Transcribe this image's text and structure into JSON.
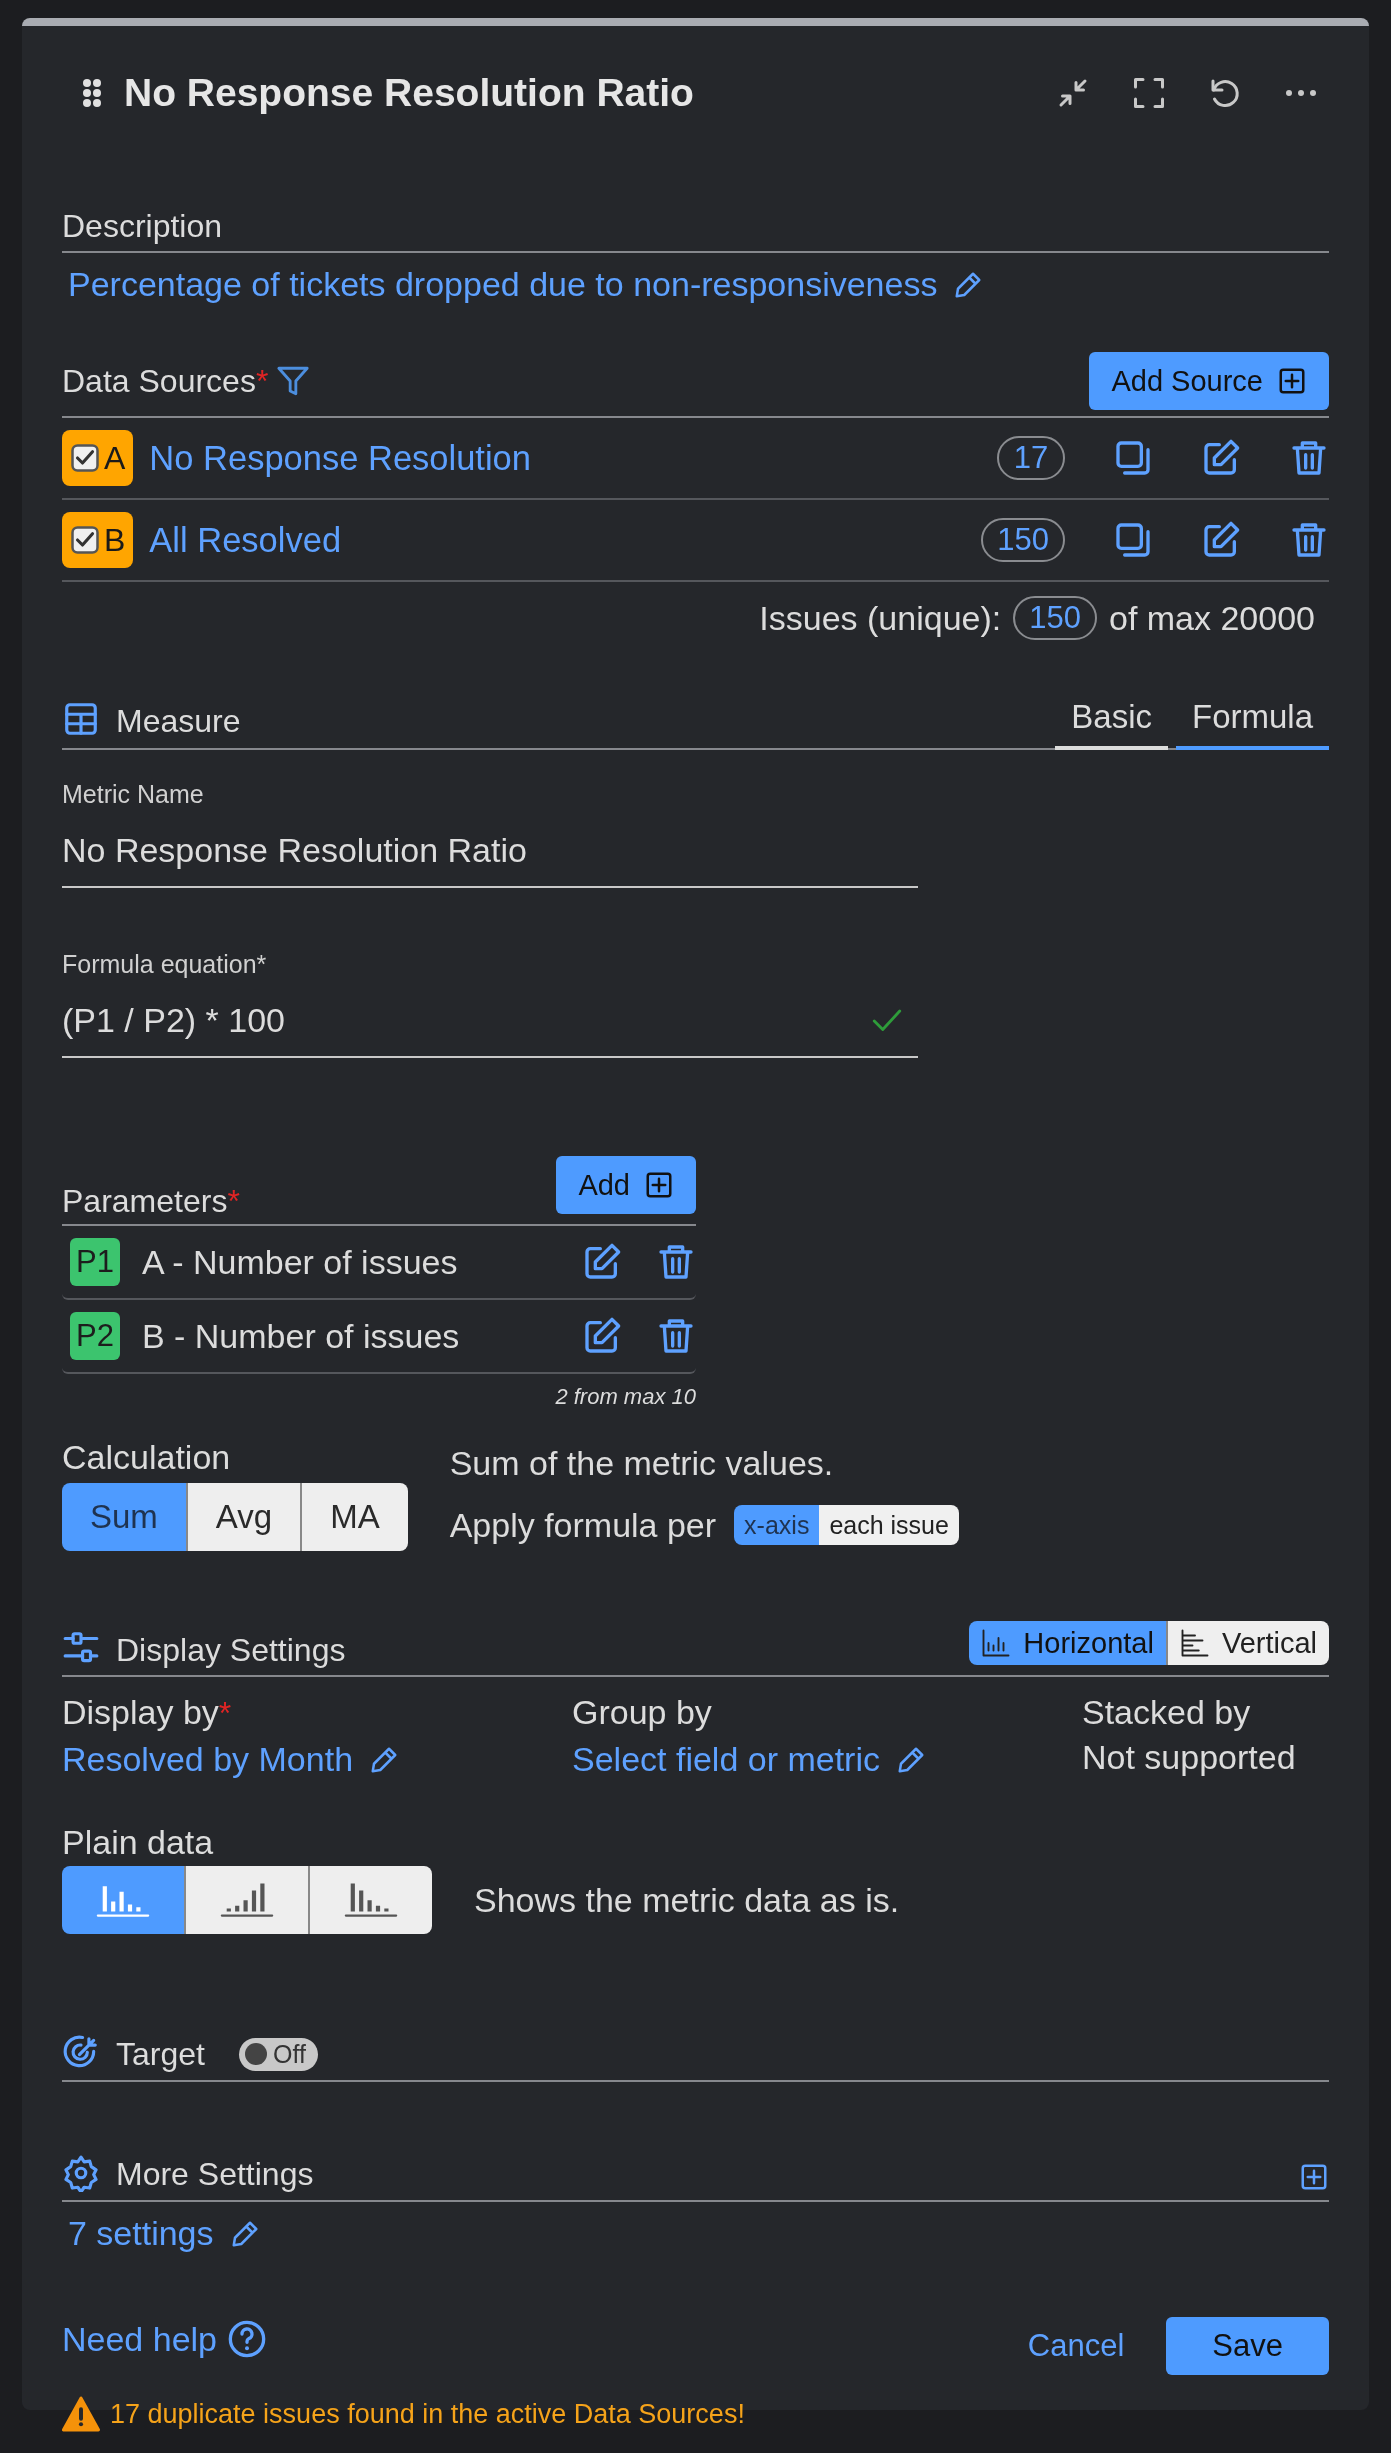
{
  "header": {
    "title": "No Response Resolution Ratio"
  },
  "description": {
    "label": "Description",
    "text": "Percentage of tickets dropped due to non-responsiveness"
  },
  "data_sources": {
    "label": "Data Sources",
    "required_mark": "*",
    "add_button": "Add Source",
    "sources": [
      {
        "letter": "A",
        "name": "No Response Resolution",
        "count": "17",
        "checked": true
      },
      {
        "letter": "B",
        "name": "All Resolved",
        "count": "150",
        "checked": true
      }
    ],
    "summary": {
      "label": "Issues (unique):",
      "count": "150",
      "suffix": "of max 20000"
    }
  },
  "measure": {
    "label": "Measure",
    "tabs": [
      {
        "label": "Basic",
        "selected": false
      },
      {
        "label": "Formula",
        "selected": true
      }
    ],
    "metric_name": {
      "label": "Metric Name",
      "value": "No Response Resolution Ratio"
    },
    "formula": {
      "label": "Formula equation*",
      "value": "(P1 / P2) * 100",
      "valid": true
    }
  },
  "parameters": {
    "label": "Parameters",
    "required_mark": "*",
    "add_button": "Add",
    "items": [
      {
        "tag": "P1",
        "text": "A - Number of issues"
      },
      {
        "tag": "P2",
        "text": "B - Number of issues"
      }
    ],
    "footnote": "2 from max 10"
  },
  "calculation": {
    "label": "Calculation",
    "options": [
      {
        "label": "Sum",
        "selected": true
      },
      {
        "label": "Avg",
        "selected": false
      },
      {
        "label": "MA",
        "selected": false
      }
    ],
    "description": "Sum of the metric values.",
    "apply_label": "Apply formula per",
    "apply_options": [
      {
        "label": "x-axis",
        "selected": true
      },
      {
        "label": "each issue",
        "selected": false
      }
    ]
  },
  "display_settings": {
    "label": "Display Settings",
    "orientation": [
      {
        "label": "Horizontal",
        "kind": "columns",
        "selected": true
      },
      {
        "label": "Vertical",
        "kind": "bars",
        "selected": false
      }
    ],
    "display_by": {
      "label": "Display by",
      "required_mark": "*",
      "value": "Resolved by Month"
    },
    "group_by": {
      "label": "Group by",
      "value": "Select field or metric"
    },
    "stacked_by": {
      "label": "Stacked by",
      "value": "Not supported"
    },
    "plain_data": {
      "label": "Plain data",
      "options": [
        {
          "kind": "plain",
          "selected": true
        },
        {
          "kind": "ascending",
          "selected": false
        },
        {
          "kind": "descending",
          "selected": false
        }
      ],
      "description": "Shows the metric data as is."
    }
  },
  "target": {
    "label": "Target",
    "toggle": {
      "on": false,
      "label": "Off"
    }
  },
  "more_settings": {
    "label": "More Settings",
    "link": "7 settings"
  },
  "footer": {
    "help": "Need help",
    "cancel": "Cancel",
    "save": "Save",
    "warning": "17 duplicate issues found in the active Data Sources!"
  }
}
